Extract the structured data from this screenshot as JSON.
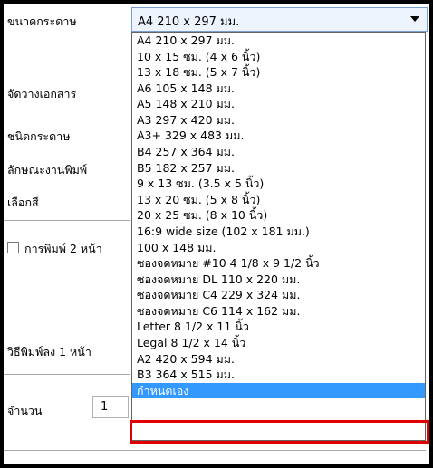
{
  "form": {
    "paper_size_label": "ขนาดกระดาษ",
    "orientation_label": "จัดวางเอกสาร",
    "paper_type_label": "ชนิดกระดาษ",
    "print_quality_label": "ลักษณะงานพิมพ์",
    "color_label": "เลือกสี",
    "duplex_label": "การพิมพ์ 2 หน้า",
    "simplex_label": "วิธีพิมพ์ลง 1 หน้า",
    "copies_label": "จำนวน",
    "copies_value": "1"
  },
  "paper_size_select": {
    "selected_value": "A4 210 x 297 มม.",
    "options": [
      "A4 210 x 297 มม.",
      "10 x 15 ซม. (4 x 6 นิ้ว)",
      "13 x 18 ซม. (5 x 7 นิ้ว)",
      "A6 105 x 148 มม.",
      "A5 148 x 210 มม.",
      "A3 297 x 420 มม.",
      "A3+ 329 x 483 มม.",
      "B4 257 x 364 มม.",
      "B5 182 x 257 มม.",
      "9 x 13 ซม. (3.5 x 5 นิ้ว)",
      "13 x 20 ซม. (5 x 8 นิ้ว)",
      "20 x 25 ซม. (8 x 10 นิ้ว)",
      "16:9 wide size (102 x 181 มม.)",
      "100 x 148 มม.",
      "ซองจดหมาย #10 4 1/8 x 9 1/2 นิ้ว",
      "ซองจดหมาย DL  110 x 220 มม.",
      "ซองจดหมาย C4  229 x 324 มม.",
      "ซองจดหมาย C6  114 x 162 มม.",
      "Letter 8 1/2 x 11 นิ้ว",
      "Legal 8 1/2 x 14 นิ้ว",
      "A2 420 x 594 มม.",
      "B3 364 x 515 มม.",
      "กำหนดเอง"
    ],
    "highlighted_option_index": 22
  },
  "colors": {
    "selection": "#3399ff",
    "annotation_box": "#e00000"
  }
}
